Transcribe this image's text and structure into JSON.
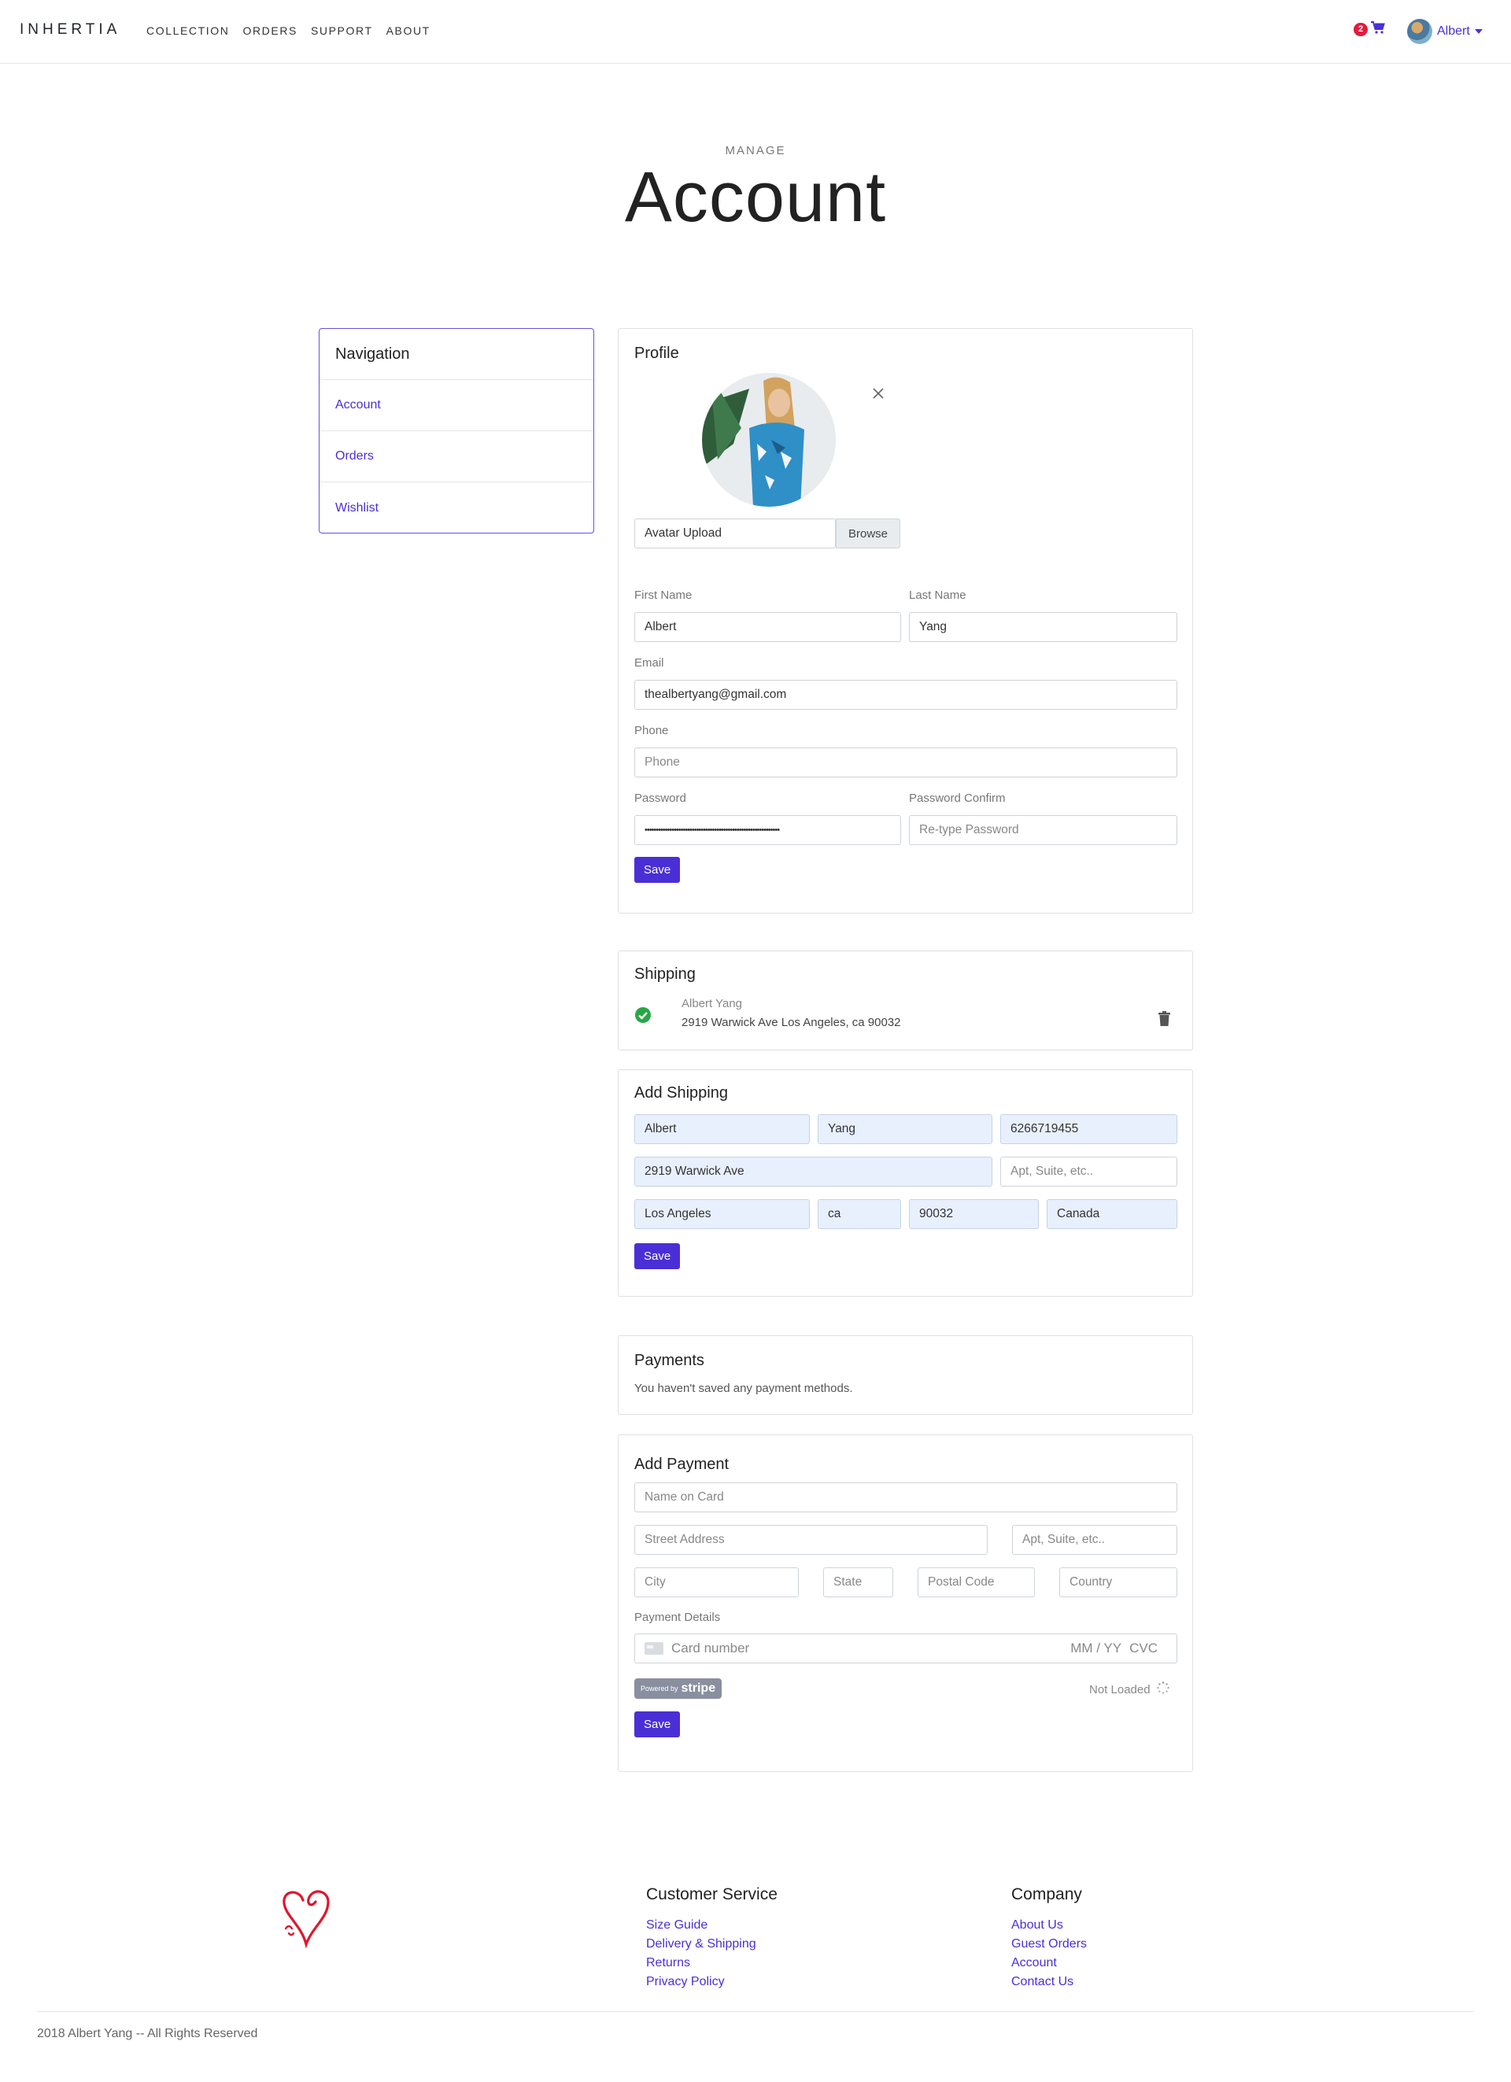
{
  "nav": {
    "brand": "INHERTIA",
    "links": [
      "COLLECTION",
      "ORDERS",
      "SUPPORT",
      "ABOUT"
    ],
    "cart_count": "2",
    "user_name": "Albert"
  },
  "header": {
    "pre_title": "MANAGE",
    "title": "Account"
  },
  "sidebar": {
    "title": "Navigation",
    "items": [
      "Account",
      "Orders",
      "Wishlist"
    ]
  },
  "profile": {
    "title": "Profile",
    "avatar_upload": "Avatar Upload",
    "browse": "Browse",
    "first_name_label": "First Name",
    "first_name": "Albert",
    "last_name_label": "Last Name",
    "last_name": "Yang",
    "email_label": "Email",
    "email": "thealbertyang@gmail.com",
    "phone_label": "Phone",
    "phone_placeholder": "Phone",
    "password_label": "Password",
    "password_value": "••••••••••••••••••••••••••••••••••••••••••••••••••••••••••••",
    "password_confirm_label": "Password Confirm",
    "password_confirm_placeholder": "Re-type Password",
    "save": "Save"
  },
  "shipping": {
    "title": "Shipping",
    "name": "Albert Yang",
    "address": "2919 Warwick Ave Los Angeles, ca 90032"
  },
  "add_shipping": {
    "title": "Add Shipping",
    "first_name": "Albert",
    "last_name": "Yang",
    "phone": "6266719455",
    "street": "2919 Warwick Ave",
    "apt_placeholder": "Apt, Suite, etc..",
    "city": "Los Angeles",
    "state": "ca",
    "zip": "90032",
    "country": "Canada",
    "save": "Save"
  },
  "payments": {
    "title": "Payments",
    "empty_text": "You haven't saved any payment methods."
  },
  "add_payment": {
    "title": "Add Payment",
    "name_placeholder": "Name on Card",
    "street_placeholder": "Street Address",
    "apt_placeholder": "Apt, Suite, etc..",
    "city_placeholder": "City",
    "state_placeholder": "State",
    "postal_placeholder": "Postal Code",
    "country_placeholder": "Country",
    "details_label": "Payment Details",
    "card_placeholder": "Card number",
    "expiry_placeholder": "MM / YY",
    "cvc_placeholder": "CVC",
    "powered_by": "Powered by",
    "stripe": "stripe",
    "status": "Not Loaded",
    "save": "Save"
  },
  "footer": {
    "customer_service": {
      "title": "Customer Service",
      "links": [
        "Size Guide",
        "Delivery & Shipping",
        "Returns",
        "Privacy Policy"
      ]
    },
    "company": {
      "title": "Company",
      "links": [
        "About Us",
        "Guest Orders",
        "Account",
        "Contact Us"
      ]
    },
    "copyright": "2018 Albert Yang -- All Rights Reserved"
  },
  "colors": {
    "accent": "#4a2fd6",
    "badge": "#e31b3c",
    "success": "#28a745",
    "autofill": "#e8f0fe"
  }
}
